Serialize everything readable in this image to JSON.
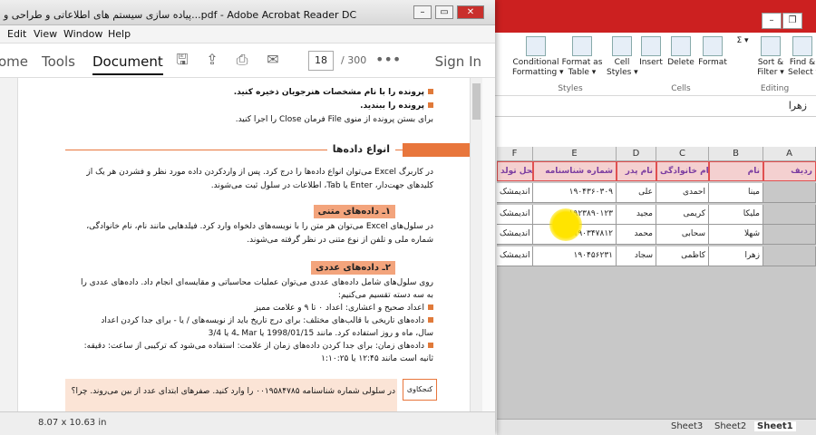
{
  "excel": {
    "ribbon": {
      "conditional_formatting": "Conditional\nFormatting ▾",
      "format_as_table": "Format as\nTable ▾",
      "cell_styles": "Cell\nStyles ▾",
      "styles_group": "Styles",
      "insert": "Insert",
      "delete": "Delete",
      "format": "Format",
      "cells_group": "Cells",
      "sort_filter": "Sort &\nFilter ▾",
      "find_select": "Find &\nSelect ▾",
      "editing_group": "Editing",
      "sigma": "Σ ▾"
    },
    "formula_value": "زهرا",
    "columns": [
      "F",
      "E",
      "D",
      "C",
      "B",
      "A"
    ],
    "header_row": [
      "محل تولد",
      "شماره شناسنامه",
      "نام پدر",
      "نام خانوادگی",
      "نام",
      "ردیف"
    ],
    "rows": [
      [
        "اندیمشک",
        "۱۹۰۴۳۶۰۳۰۹",
        "علی",
        "احمدی",
        "مینا",
        ""
      ],
      [
        "اندیمشک",
        "۱۹۲۳۸۹۰۱۲۳",
        "مجید",
        "کریمی",
        "ملیکا",
        ""
      ],
      [
        "اندیمشک",
        "۱۹۰۳۴۷۸۱۲",
        "محمد",
        "سحابی",
        "شهلا",
        ""
      ],
      [
        "اندیمشک",
        "۱۹۰۴۵۶۲۳۱",
        "سجاد",
        "کاظمی",
        "زهرا",
        ""
      ]
    ],
    "sheets": [
      "Sheet3",
      "Sheet2",
      "Sheet1"
    ],
    "active_sheet": "Sheet1"
  },
  "acrobat": {
    "title": "پیاده سازی سیستم های اطلاعاتی و طراحی و...pdf - Adobe Acrobat Reader DC",
    "menu": [
      "Edit",
      "View",
      "Window",
      "Help"
    ],
    "tabs": {
      "home": "ome",
      "tools": "Tools",
      "document": "Document"
    },
    "page_number": "18",
    "page_total": "/  300",
    "sign_in": "Sign In",
    "status_size": "8.07 x 10.63 in",
    "content": {
      "line1": "پرونده را با نام مشخصات هنرجویان ذخیره کنید.",
      "line2": "پرونده را ببندید.",
      "line3": "برای بستن پرونده از منوی File فرمان Close را اجرا کنید.",
      "section_title": "انواع داده‌ها",
      "para1a": "در کاربرگ Excel می‌توان انواع داده‌ها را درج کرد. پس از واردکردن داده مورد نظر و فشردن هر یک از",
      "para1b": "کلیدهای جهت‌دار، Enter یا Tab، اطلاعات در سلول ثبت می‌شوند.",
      "sub1": "۱ـ داده‌های متنی",
      "para2a": "در سلول‌های Excel می‌توان هر متن را با نویسه‌های دلخواه وارد کرد. فیلدهایی مانند نام، نام خانوادگی،",
      "para2b": "شماره ملی و تلفن از نوع متنی در نظر گرفته می‌شوند.",
      "sub2": "۲ـ داده‌های عددی",
      "para3a": "روی سلول‌های شامل داده‌های عددی می‌توان عملیات محاسباتی و مقایسه‌ای انجام داد. داده‌های عددی را",
      "para3b": "به سه دسته تقسیم می‌کنیم:",
      "b1": "اعداد صحیح و اعشاری: اعداد ۰ تا ۹ و علامت ممیز",
      "b2a": "داده‌های تاریخی با قالب‌های مختلف: برای درج تاریخ باید از نویسه‌های / یا - برای جدا کردن اعداد",
      "b2b": "سال، ماه و روز استفاده کرد. مانند 1998/01/15 یا Mar ـ4 یا 3/4",
      "b3a": "داده‌های زمان: برای جدا کردن داده‌های زمان از علامت: استفاده می‌شود که ترکیبی از ساعت: دقیقه:",
      "b3b": "ثانیه است مانند ۱۲:۴۵ یا ۱:۱۰:۲۵",
      "tip_label": "کنجکاوی",
      "tip_text": "در سلولی شماره شناسنامه ۰۰۱۹۵۸۴۷۸۵ را وارد کنید. صفرهای ابتدای عدد از بین می‌روند. چرا؟"
    }
  }
}
